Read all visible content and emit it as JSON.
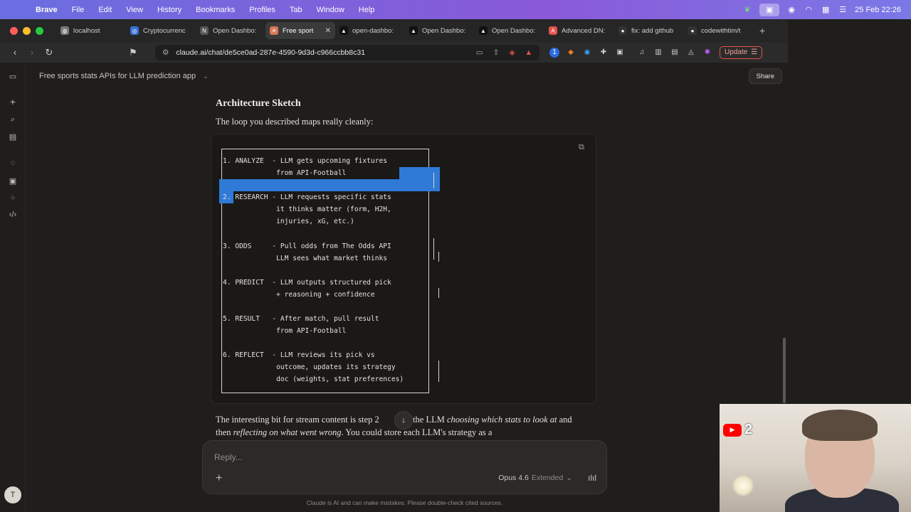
{
  "menubar": {
    "app": "Brave",
    "items": [
      "File",
      "Edit",
      "View",
      "History",
      "Bookmarks",
      "Profiles",
      "Tab",
      "Window",
      "Help"
    ],
    "date_time": "25 Feb  22:26"
  },
  "tabs": [
    {
      "title": "localhost",
      "icon": "globe-icon",
      "color": "#7a7a7a",
      "active": false
    },
    {
      "title": "Cryptocurrenc",
      "icon": "crypto-icon",
      "color": "#3b6fd8",
      "active": false
    },
    {
      "title": "Open Dashbo:",
      "icon": "notion-icon",
      "color": "#555555",
      "active": false
    },
    {
      "title": "Free sport",
      "icon": "claude-icon",
      "color": "#d97757",
      "active": true
    },
    {
      "title": "open-dashbo:",
      "icon": "vercel-icon",
      "color": "#111111",
      "active": false
    },
    {
      "title": "Open Dashbo:",
      "icon": "vercel-icon",
      "color": "#111111",
      "active": false
    },
    {
      "title": "Open Dashbo:",
      "icon": "vercel-icon",
      "color": "#111111",
      "active": false
    },
    {
      "title": "Advanced DN:",
      "icon": "advanced-icon",
      "color": "#e2544b",
      "active": false
    },
    {
      "title": "fix: add github",
      "icon": "github-icon",
      "color": "#333333",
      "active": false
    },
    {
      "title": "codewithtim/t",
      "icon": "github-icon",
      "color": "#333333",
      "active": false
    }
  ],
  "toolbar": {
    "url": "claude.ai/chat/de5ce0ad-287e-4590-9d3d-c966ccbb8c31",
    "update_label": "Update"
  },
  "chat": {
    "title": "Free sports stats APIs for LLM prediction app",
    "share_label": "Share"
  },
  "message": {
    "heading": "Architecture Sketch",
    "intro": "The loop you described maps really cleanly:",
    "steps": [
      "1. ANALYZE  - LLM gets upcoming fixtures\n             from API-Football",
      "2. RESEARCH - LLM requests specific stats\n             it thinks matter (form, H2H,\n             injuries, xG, etc.)",
      "3. ODDS     - Pull odds from The Odds API\n             LLM sees what market thinks",
      "4. PREDICT  - LLM outputs structured pick\n             + reasoning + confidence",
      "5. RESULT   - After match, pull result\n             from API-Football",
      "6. REFLECT  - LLM reviews its pick vs\n             outcome, updates its strategy\n             doc (weights, stat preferences)"
    ],
    "para_start": "The interesting bit for stream content is step 2 ",
    "para_mid": " 6 — the LLM ",
    "para_em1": "choosing which stats to look at",
    "para_and": " and then ",
    "para_em2": "reflecting on what went wrong",
    "para_end": ". You could store each LLM's strategy as a"
  },
  "composer": {
    "placeholder": "Reply...",
    "model": "Opus 4.6",
    "mode": "Extended"
  },
  "disclaimer": "Claude is AI and can make mistakes. Please double-check cited sources.",
  "rail": {
    "avatar_initial": "T"
  },
  "webcam": {
    "badge_number": "2"
  }
}
